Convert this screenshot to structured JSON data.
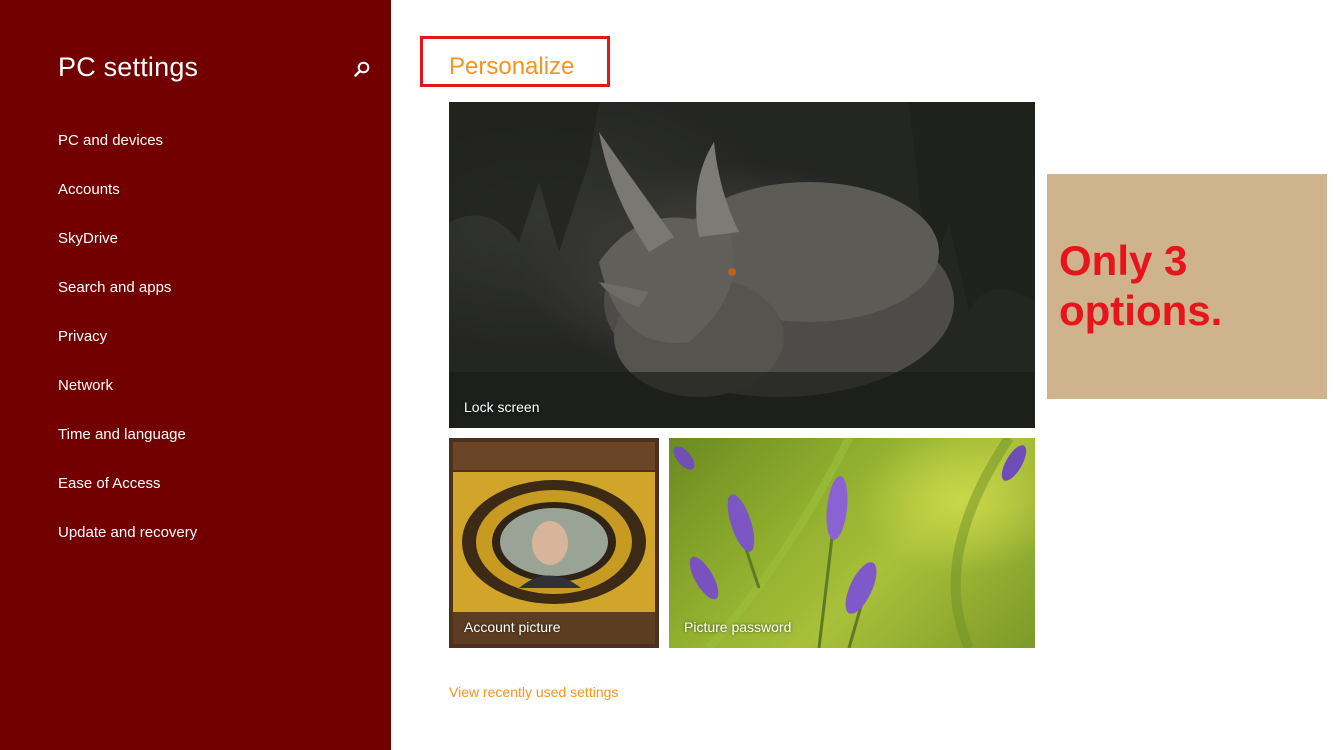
{
  "sidebar": {
    "title": "PC settings",
    "search_icon": "search-icon",
    "background": "#720000",
    "items": [
      {
        "label": "PC and devices"
      },
      {
        "label": "Accounts"
      },
      {
        "label": "SkyDrive"
      },
      {
        "label": "Search and apps"
      },
      {
        "label": "Privacy"
      },
      {
        "label": "Network"
      },
      {
        "label": "Time and language"
      },
      {
        "label": "Ease of Access"
      },
      {
        "label": "Update and recovery"
      }
    ]
  },
  "main": {
    "title": "Personalize",
    "accent": "#f7931e",
    "tiles": {
      "lock_screen": "Lock screen",
      "account_picture": "Account picture",
      "picture_password": "Picture password"
    },
    "link": "View recently used settings"
  },
  "annotation": {
    "text": "Only 3 options.",
    "highlight_color": "#e8141b",
    "box_color": "#cfb38c"
  }
}
